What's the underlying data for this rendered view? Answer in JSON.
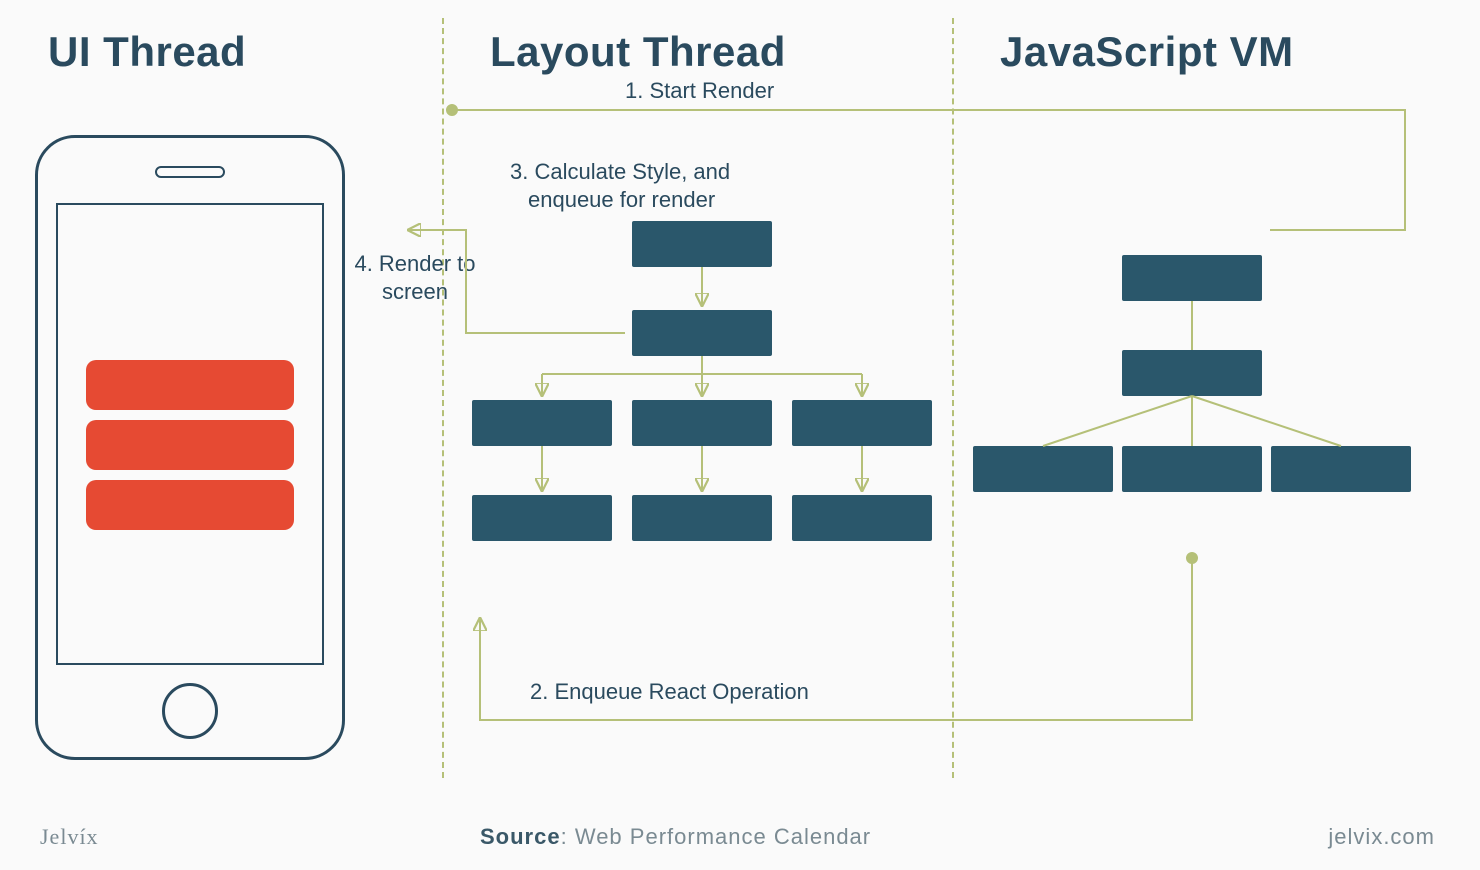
{
  "columns": {
    "ui": {
      "title": "UI Thread"
    },
    "layout": {
      "title": "Layout Thread"
    },
    "jsvm": {
      "title": "JavaScript VM"
    }
  },
  "steps": {
    "start_render": "1. Start Render",
    "enqueue_react": "2. Enqueue React Operation",
    "calc_style_l1": "3. Calculate Style, and",
    "calc_style_l2": "enqueue for render",
    "render_to_l1": "4. Render to",
    "render_to_l2": "screen"
  },
  "footer": {
    "brand": "Jelvíx",
    "source_label": "Source",
    "source_value": "Web Performance Calendar",
    "site": "jelvix.com"
  },
  "colors": {
    "text": "#2a4a5e",
    "node": "#2a576b",
    "accent": "#e64a33",
    "olive": "#b5c078"
  }
}
